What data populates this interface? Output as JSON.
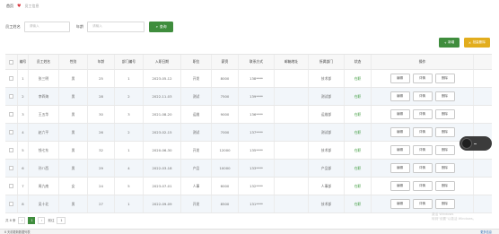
{
  "breadcrumb": {
    "home": "首页",
    "current": "员工信息"
  },
  "search": {
    "field1_label": "员工姓名",
    "field1_placeholder": "请输入",
    "field2_label": "年龄",
    "field2_placeholder": "请输入",
    "button_label": "查询"
  },
  "toolbar": {
    "add_label": "新增",
    "delete_label": "批量删除"
  },
  "table": {
    "headers": [
      "",
      "编号",
      "员工姓名",
      "性别",
      "年龄",
      "部门编号",
      "入职日期",
      "职位",
      "薪资",
      "联系方式",
      "邮箱地址",
      "所属部门",
      "状态",
      "操作"
    ],
    "rows": [
      [
        "",
        "1",
        "张三明",
        "男",
        "25",
        "1",
        "2023-05-12",
        "开发",
        "8000",
        "138****",
        "",
        "技术部",
        "在职"
      ],
      [
        "",
        "2",
        "李四海",
        "男",
        "28",
        "2",
        "2022-11-03",
        "测试",
        "7500",
        "139****",
        "",
        "测试部",
        "在职"
      ],
      [
        "",
        "3",
        "王五华",
        "男",
        "30",
        "3",
        "2021-08-20",
        "运维",
        "9000",
        "136****",
        "",
        "运维部",
        "在职"
      ],
      [
        "",
        "4",
        "赵六平",
        "男",
        "26",
        "2",
        "2023-02-15",
        "测试",
        "7000",
        "137****",
        "",
        "测试部",
        "在职"
      ],
      [
        "",
        "5",
        "钱七东",
        "男",
        "32",
        "1",
        "2020-06-30",
        "开发",
        "12000",
        "135****",
        "",
        "技术部",
        "在职"
      ],
      [
        "",
        "6",
        "孙八西",
        "男",
        "29",
        "4",
        "2022-03-18",
        "产品",
        "10000",
        "133****",
        "",
        "产品部",
        "在职"
      ],
      [
        "",
        "7",
        "周九南",
        "女",
        "24",
        "5",
        "2023-07-01",
        "人事",
        "6000",
        "132****",
        "",
        "人事部",
        "在职"
      ],
      [
        "",
        "8",
        "吴十北",
        "男",
        "27",
        "1",
        "2022-09-09",
        "开发",
        "8500",
        "131****",
        "",
        "技术部",
        "在职"
      ]
    ],
    "actions": [
      "编辑",
      "详情",
      "删除"
    ]
  },
  "pagination": {
    "total_label": "共 8 条",
    "pages": [
      "1"
    ],
    "goto_label": "前往",
    "goto_value": "1"
  },
  "watermark": {
    "line1": "激活 Windows",
    "line2": "转到\"设置\"以激活 Windows。"
  },
  "statusbar": {
    "left": "8 天前更新数据列表",
    "right": "更多信息"
  },
  "colors": {
    "primary": "#3f8d3d",
    "warning": "#e2ad1d",
    "status_green": "#3c9a3c"
  }
}
